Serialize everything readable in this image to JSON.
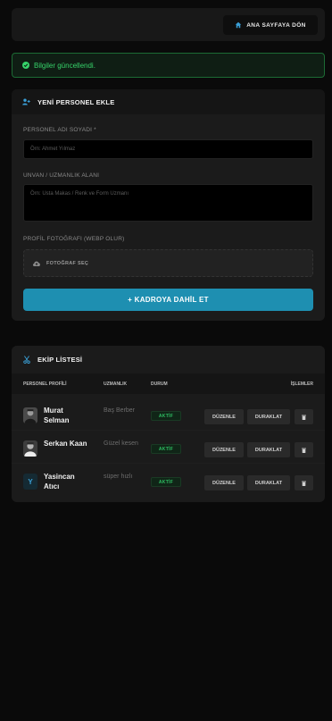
{
  "header": {
    "home_label": "ANA SAYFAYA DÖN",
    "home_icon": "home-icon"
  },
  "alert": {
    "message": "Bilgiler güncellendi.",
    "color": "#36d36a"
  },
  "form": {
    "title": "YENİ PERSONEL EKLE",
    "name_label": "PERSONEL ADI SOYADI *",
    "name_placeholder": "Örn: Ahmet Yılmaz",
    "title_label": "UNVAN / UZMANLIK ALANI",
    "title_placeholder": "Örn: Usta Makas / Renk ve Form Uzmanı",
    "photo_label": "PROFİL FOTOĞRAFI (WEBP OLUR)",
    "photo_button": "FOTOĞRAF SEÇ",
    "submit_label": "+ KADROYA DAHİL ET",
    "accent": "#1e8fb1"
  },
  "team": {
    "title": "EKİP LİSTESİ",
    "columns": [
      "PERSONEL PROFİLİ",
      "UZMANLIK",
      "DURUM",
      "İŞLEMLER"
    ],
    "rows": [
      {
        "name": "Murat Selman",
        "specialty": "Baş Berber",
        "status": "AKTİF",
        "edit": "DÜZENLE",
        "pause": "DURAKLAT",
        "avatar": "photo"
      },
      {
        "name": "Serkan Kaan",
        "specialty": "Güzel kesen",
        "status": "AKTİF",
        "edit": "DÜZENLE",
        "pause": "DURAKLAT",
        "avatar": "photo"
      },
      {
        "name": "Yasincan Atıcı",
        "specialty": "süper hızlı",
        "status": "AKTİF",
        "edit": "DÜZENLE",
        "pause": "DURAKLAT",
        "avatar": "Y"
      }
    ]
  }
}
